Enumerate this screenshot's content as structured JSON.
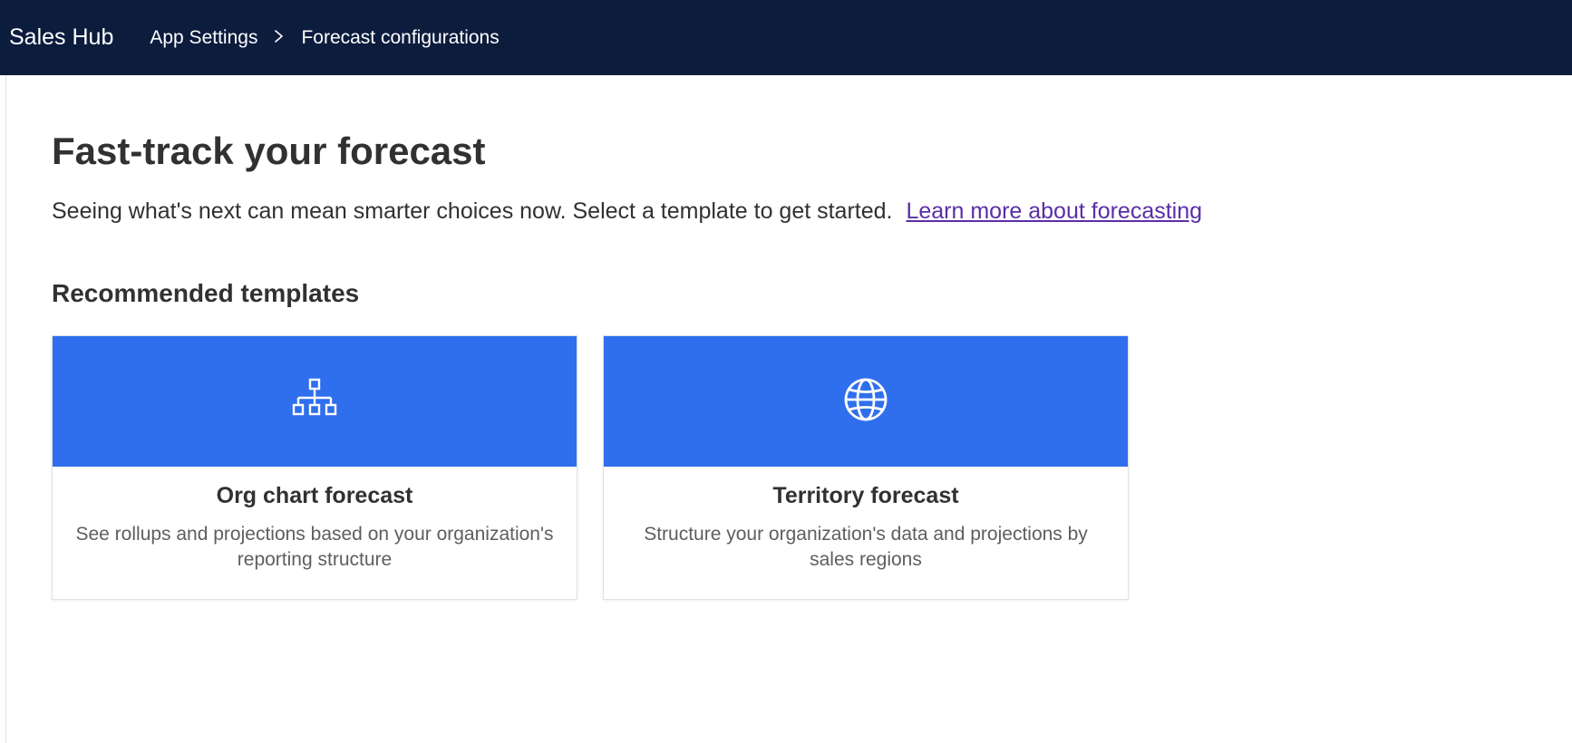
{
  "header": {
    "app_title": "Sales Hub",
    "breadcrumb": {
      "item1": "App Settings",
      "item2": "Forecast configurations"
    }
  },
  "main": {
    "title": "Fast-track your forecast",
    "description": "Seeing what's next can mean smarter choices now. Select a template to get started.",
    "learn_more": "Learn more about forecasting",
    "section_title": "Recommended templates",
    "cards": [
      {
        "icon": "org-chart-icon",
        "title": "Org chart forecast",
        "description": "See rollups and projections based on your organization's reporting structure"
      },
      {
        "icon": "globe-icon",
        "title": "Territory forecast",
        "description": "Structure your organization's data and projections by sales regions"
      }
    ]
  }
}
